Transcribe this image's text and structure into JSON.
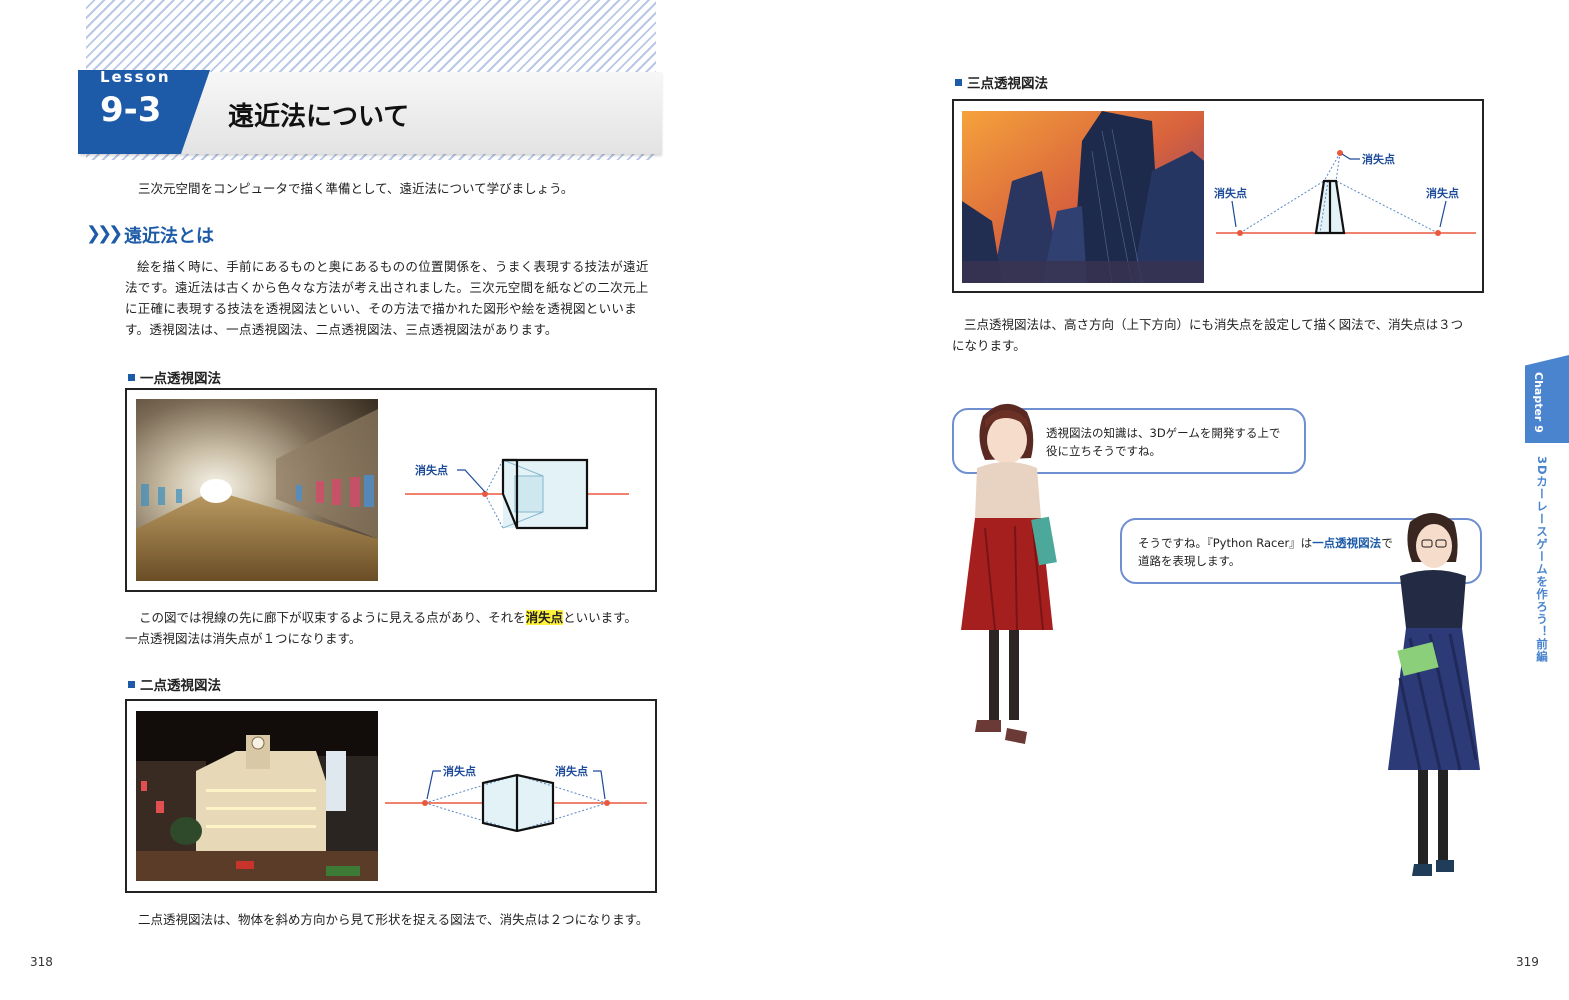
{
  "left": {
    "lesson_word": "Lesson",
    "lesson_number": "9-3",
    "lesson_title": "遠近法について",
    "intro": "三次元空間をコンピュータで描く準備として、遠近法について学びましょう。",
    "section_arrows": "❯❯❯",
    "section_title": "遠近法とは",
    "paragraph": [
      "絵を描く時に、手前にあるものと奥にあるものの位置関係を、うまく表現する技法が遠近",
      "法です。遠近法は古くから色々な方法が考え出されました。三次元空間を紙などの二次元上",
      "に正確に表現する技法を透視図法といい、その方法で描かれた図形や絵を透視図といいま",
      "す。透視図法は、一点透視図法、二点透視図法、三点透視図法があります。"
    ],
    "one_point": {
      "heading": "一点透視図法",
      "vp_label": "消失点",
      "caption_before": "この図では視線の先に廊下が収束するように見える点があり、それを",
      "caption_highlight": "消失点",
      "caption_after": "といいます。",
      "caption_line2": "一点透視図法は消失点が１つになります。"
    },
    "two_point": {
      "heading": "二点透視図法",
      "vp_label_left": "消失点",
      "vp_label_right": "消失点",
      "caption": "二点透視図法は、物体を斜め方向から見て形状を捉える図法で、消失点は２つになります。"
    },
    "page_number": "318"
  },
  "right": {
    "three_point": {
      "heading": "三点透視図法",
      "vp_label_top": "消失点",
      "vp_label_left": "消失点",
      "vp_label_right": "消失点",
      "caption_line1": "三点透視図法は、高さ方向（上下方向）にも消失点を設定して描く図法で、消失点は３つ",
      "caption_line2": "になります。"
    },
    "bubble1": {
      "line1": "透視図法の知識は、3Dゲームを開発する上で",
      "line2": "役に立ちそうですね。"
    },
    "bubble2": {
      "line1_before": "そうですね。『Python Racer』は",
      "line1_bold": "一点透視図法",
      "line1_after": "で",
      "line2": "道路を表現します。"
    },
    "chapter_tab": "Chapter 9",
    "chapter_side": "3Dカーレースゲームを作ろう！前編",
    "page_number": "319"
  },
  "colors": {
    "accent": "#1d5aa8",
    "highlight": "#fff23a",
    "horizon": "#e8593f",
    "bubble_border": "#6f8fd0"
  }
}
